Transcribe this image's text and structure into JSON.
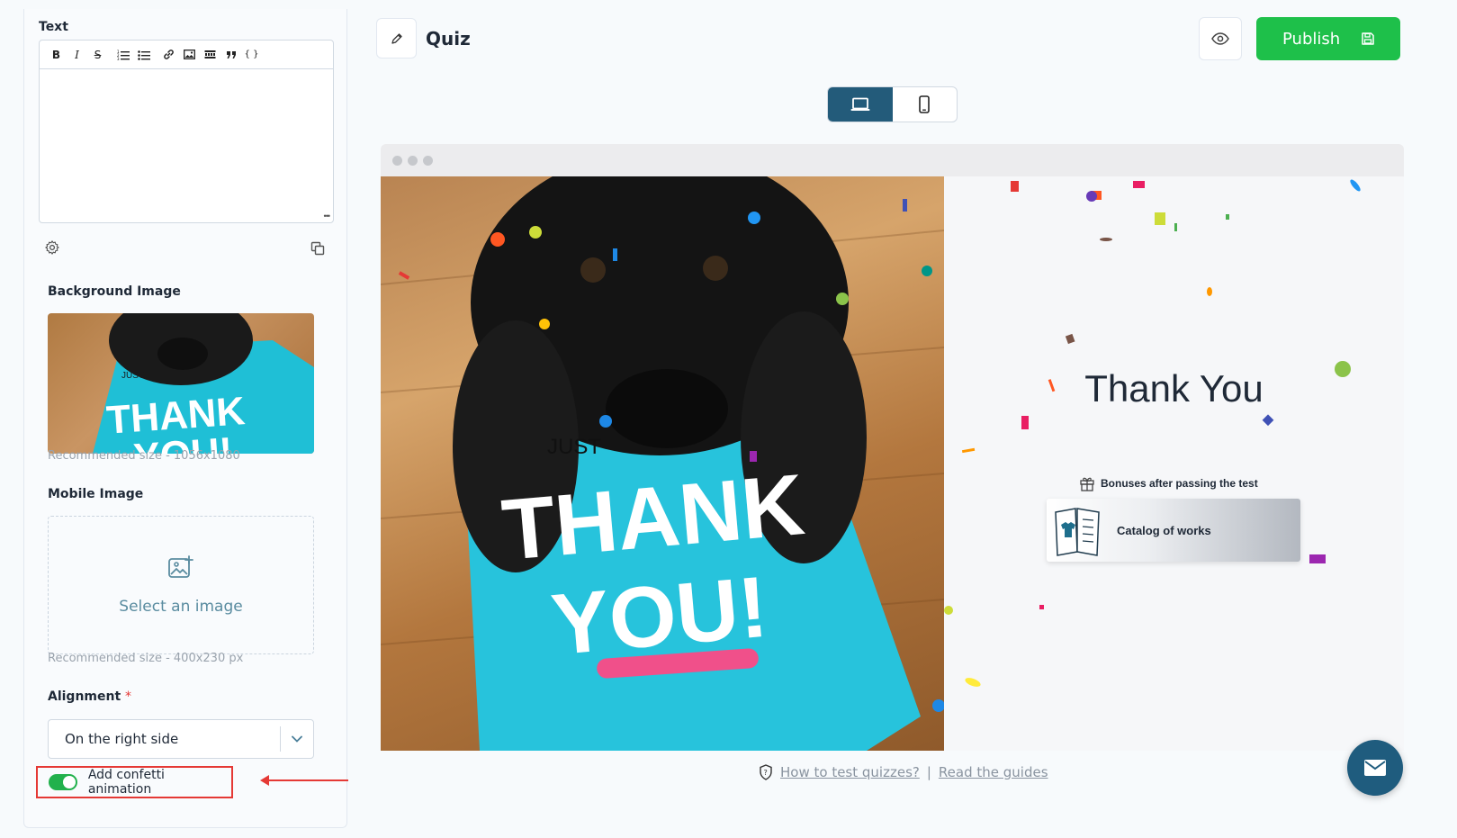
{
  "sidebar": {
    "text_label": "Text",
    "toolbar": {
      "bold": "B",
      "italic": "I",
      "strike": "S",
      "code": "{ }"
    },
    "background_label": "Background Image",
    "background_hint": "Recommended size - 1056x1080",
    "mobile_label": "Mobile Image",
    "select_image_text": "Select an image",
    "mobile_hint": "Recommended size - 400x230 px",
    "alignment_label": "Alignment",
    "alignment_required": "*",
    "alignment_value": "On the right side",
    "confetti_label": "Add confetti animation",
    "confetti_enabled": true
  },
  "header": {
    "title": "Quiz",
    "publish_label": "Publish"
  },
  "device_switch": {
    "active": "desktop",
    "options": [
      "desktop",
      "mobile"
    ]
  },
  "preview": {
    "thank_you": "Thank You",
    "bonus_heading": "Bonuses after passing the test",
    "bonus_card_title": "Catalog of works",
    "image_card_text": {
      "just": "JUST",
      "thank": "THANK",
      "you": "YOU!"
    },
    "thumb_card_text": {
      "just": "JUST",
      "thank": "THANK",
      "you": "YOU!"
    }
  },
  "footer": {
    "link_test": "How to test quizzes?",
    "divider": "|",
    "link_guides": "Read the guides"
  },
  "colors": {
    "accent_green": "#1ec04a",
    "brand_blue": "#235b7a",
    "highlight_red": "#e53935"
  },
  "icons": [
    "pencil-icon",
    "eye-icon",
    "save-icon",
    "laptop-icon",
    "phone-icon",
    "gear-icon",
    "copy-icon",
    "image-add-icon",
    "chevron-down-icon",
    "gift-icon",
    "shield-icon",
    "mail-icon"
  ]
}
